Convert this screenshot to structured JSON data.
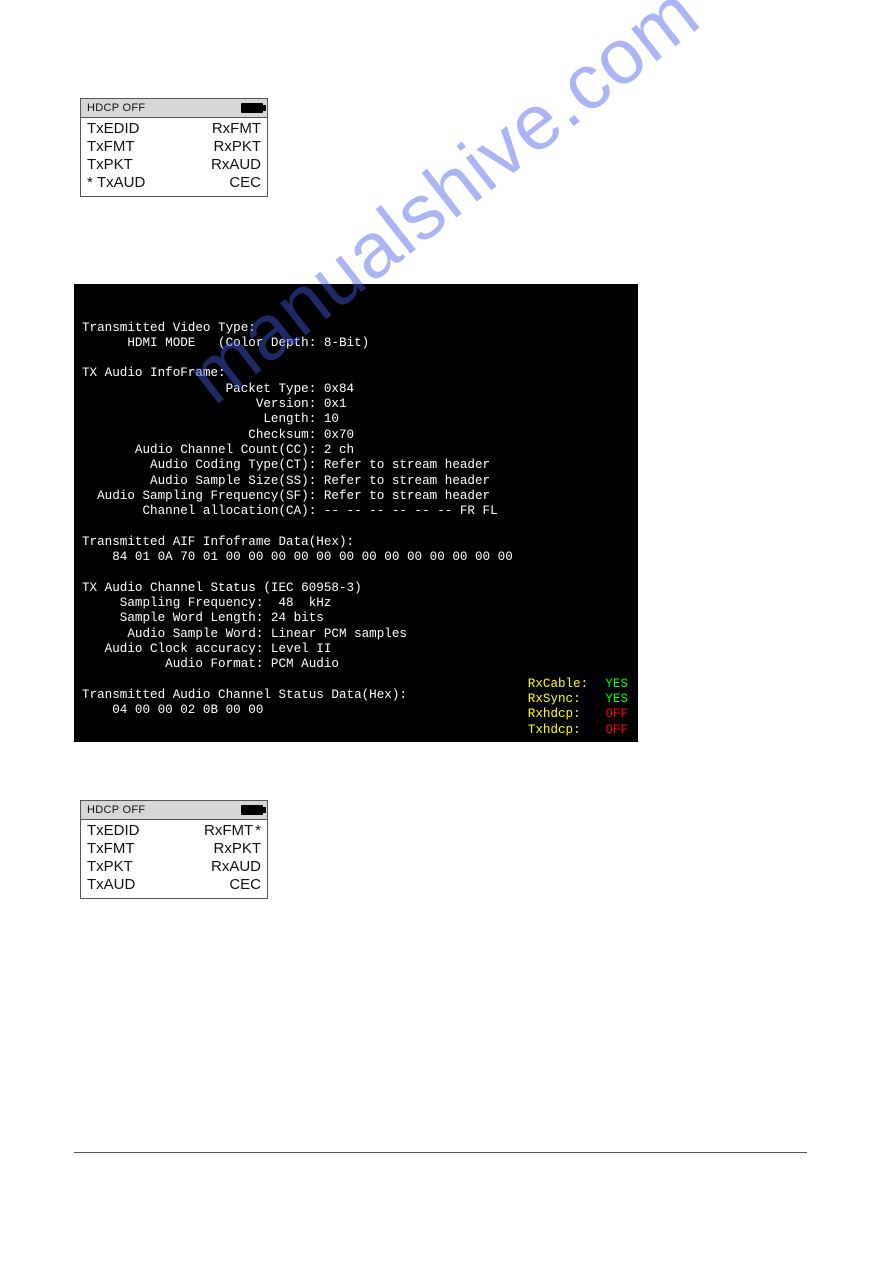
{
  "device1": {
    "header": "HDCP OFF",
    "rows": [
      {
        "left": "TxEDID",
        "right": "RxFMT"
      },
      {
        "left": "TxFMT",
        "right": "RxPKT"
      },
      {
        "left": "TxPKT",
        "right": "RxAUD"
      },
      {
        "left": "TxAUD",
        "right": "CEC"
      }
    ],
    "starred_side": "left",
    "starred_index": 3
  },
  "terminal": {
    "lines": [
      "Transmitted Video Type:",
      "      HDMI MODE   (Color Depth: 8-Bit)",
      "",
      "TX Audio InfoFrame:",
      "                   Packet Type: 0x84",
      "                       Version: 0x1",
      "                        Length: 10",
      "                      Checksum: 0x70",
      "       Audio Channel Count(CC): 2 ch",
      "         Audio Coding Type(CT): Refer to stream header",
      "         Audio Sample Size(SS): Refer to stream header",
      "  Audio Sampling Frequency(SF): Refer to stream header",
      "        Channel allocation(CA): -- -- -- -- -- -- FR FL",
      "",
      "Transmitted AIF Infoframe Data(Hex):",
      "    84 01 0A 70 01 00 00 00 00 00 00 00 00 00 00 00 00 00",
      "",
      "TX Audio Channel Status (IEC 60958-3)",
      "     Sampling Frequency:  48  kHz",
      "     Sample Word Length: 24 bits",
      "      Audio Sample Word: Linear PCM samples",
      "   Audio Clock accuracy: Level II",
      "           Audio Format: PCM Audio",
      "",
      "Transmitted Audio Channel Status Data(Hex):",
      "    04 00 00 02 0B 00 00"
    ],
    "status": [
      {
        "label": "RxCable:",
        "value": "YES",
        "class": "green"
      },
      {
        "label": "RxSync:",
        "value": "YES",
        "class": "green"
      },
      {
        "label": "Rxhdcp:",
        "value": "OFF",
        "class": "red"
      },
      {
        "label": "Txhdcp:",
        "value": "OFF",
        "class": "red"
      }
    ]
  },
  "device2": {
    "header": "HDCP OFF",
    "rows": [
      {
        "left": "TxEDID",
        "right": "RxFMT"
      },
      {
        "left": "TxFMT",
        "right": "RxPKT"
      },
      {
        "left": "TxPKT",
        "right": "RxAUD"
      },
      {
        "left": "TxAUD",
        "right": "CEC"
      }
    ],
    "starred_side": "right",
    "starred_index": 0
  },
  "watermark": "manualshive.com"
}
